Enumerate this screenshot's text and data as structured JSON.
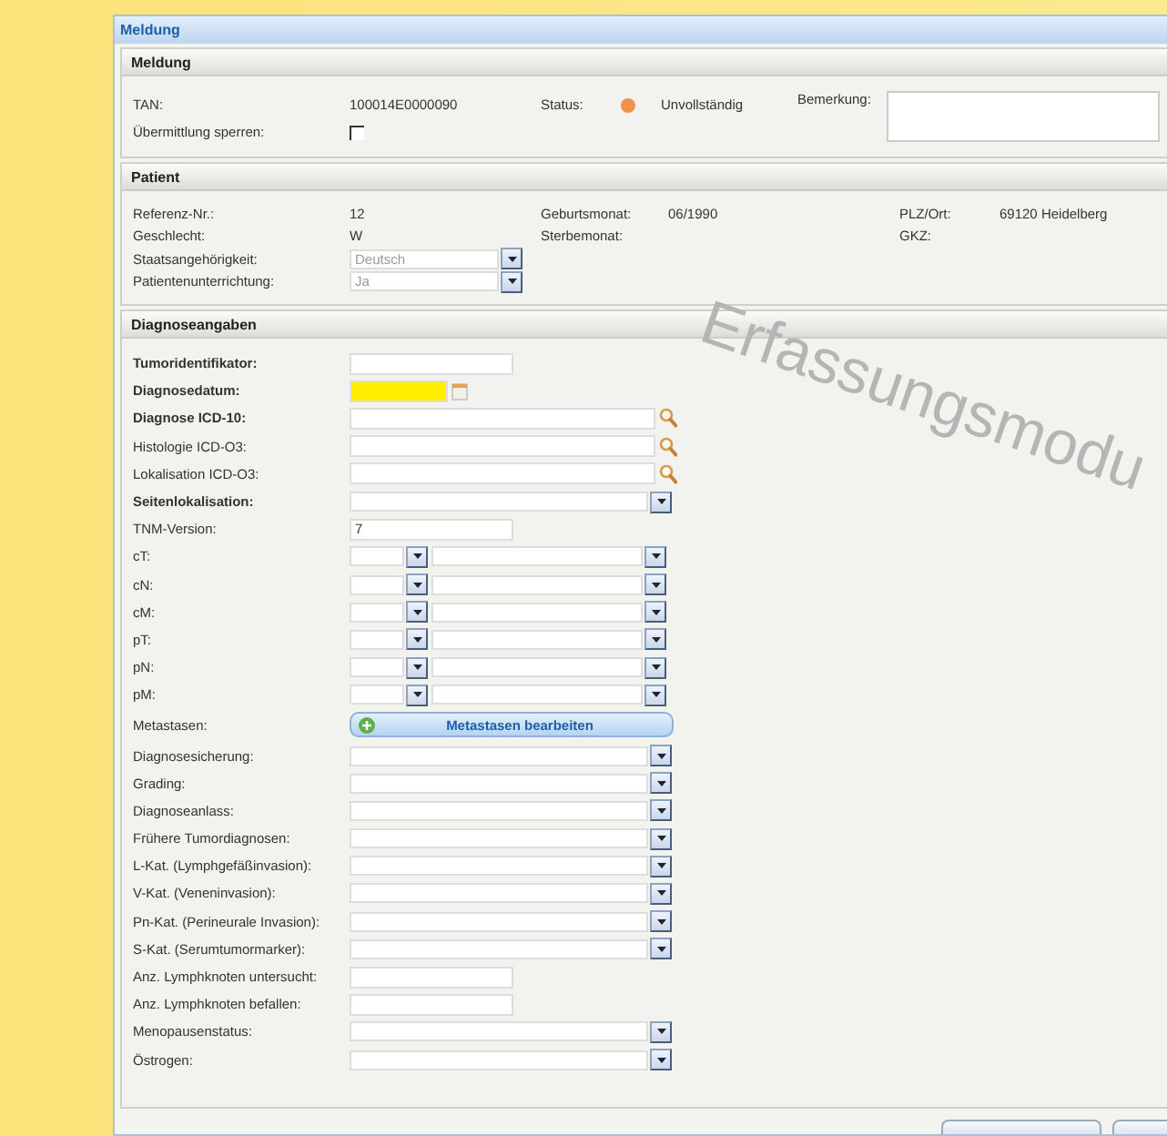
{
  "window": {
    "title": "Meldung"
  },
  "overlay_label": "Erfassungsmodu",
  "meldung": {
    "title": "Meldung",
    "tan": {
      "label": "TAN:",
      "value": "100014E0000090"
    },
    "status": {
      "label": "Status:",
      "color": "#f0904a",
      "value": "Unvollständig"
    },
    "remark": {
      "label": "Bemerkung:"
    },
    "lock": {
      "label": "Übermittlung sperren:",
      "checked": false
    }
  },
  "patient": {
    "title": "Patient",
    "rows": [
      [
        {
          "label": "Referenz-Nr.:",
          "kind": "text",
          "value": "12"
        },
        {
          "label": "Geburtsmonat:",
          "kind": "text",
          "value": "06/1990"
        },
        {
          "label": "PLZ/Ort:",
          "kind": "text",
          "value": "69120 Heidelberg"
        }
      ],
      [
        {
          "label": "Geschlecht:",
          "kind": "text",
          "value": "W"
        },
        {
          "label": "Sterbemonat:",
          "kind": "text"
        },
        {
          "label": "GKZ:",
          "kind": "text"
        }
      ],
      [
        {
          "label": "Staatsangehörigkeit:",
          "kind": "select",
          "value": "Deutsch",
          "disabled": true
        }
      ],
      [
        {
          "label": "Patientenunterrichtung:",
          "kind": "select",
          "value": "Ja",
          "disabled": true
        }
      ]
    ]
  },
  "diagnose": {
    "title": "Diagnoseangaben",
    "fields": [
      {
        "label": "Tumoridentifikator:",
        "kind": "text",
        "required": true
      },
      {
        "label": "Diagnosedatum:",
        "kind": "date",
        "required": true,
        "highlighted": true
      },
      {
        "label": "Diagnose ICD-10:",
        "kind": "search",
        "required": true
      },
      {
        "label": "Histologie ICD-O3:",
        "kind": "search",
        "required": false
      },
      {
        "label": "Lokalisation ICD-O3:",
        "kind": "search",
        "required": false
      },
      {
        "label": "Seitenlokalisation:",
        "kind": "select",
        "required": true
      },
      {
        "label": "TNM-Version:",
        "kind": "text",
        "required": false,
        "value": "7"
      },
      {
        "label": "cT:",
        "kind": "tnm",
        "required": false
      },
      {
        "label": "cN:",
        "kind": "tnm",
        "required": false
      },
      {
        "label": "cM:",
        "kind": "tnm",
        "required": false
      },
      {
        "label": "pT:",
        "kind": "tnm",
        "required": false
      },
      {
        "label": "pN:",
        "kind": "tnm",
        "required": false
      },
      {
        "label": "pM:",
        "kind": "tnm",
        "required": false
      },
      {
        "label": "Metastasen:",
        "kind": "button",
        "required": false,
        "button": "Metastasen bearbeiten"
      },
      {
        "label": "Diagnosesicherung:",
        "kind": "select",
        "required": false
      },
      {
        "label": "Grading:",
        "kind": "select",
        "required": false
      },
      {
        "label": "Diagnoseanlass:",
        "kind": "select",
        "required": false
      },
      {
        "label": "Frühere Tumordiagnosen:",
        "kind": "select",
        "required": false
      },
      {
        "label": "L-Kat. (Lymphgefäßinvasion):",
        "kind": "select",
        "required": false
      },
      {
        "label": "V-Kat. (Veneninvasion):",
        "kind": "select",
        "required": false
      },
      {
        "label": "Pn-Kat. (Perineurale Invasion):",
        "kind": "select",
        "required": false
      },
      {
        "label": "S-Kat. (Serumtumormarker):",
        "kind": "select",
        "required": false
      },
      {
        "label": "Anz. Lymphknoten untersucht:",
        "kind": "text",
        "required": false
      },
      {
        "label": "Anz. Lymphknoten befallen:",
        "kind": "text",
        "required": false
      },
      {
        "label": "Menopausenstatus:",
        "kind": "select",
        "required": false
      },
      {
        "label": "Östrogen:",
        "kind": "select",
        "required": false
      }
    ]
  }
}
